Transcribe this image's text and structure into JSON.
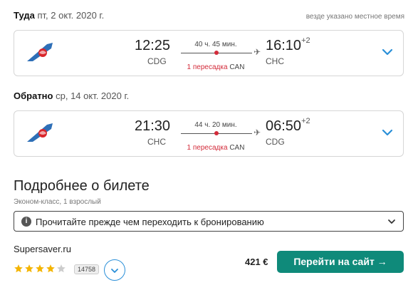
{
  "outbound": {
    "label": "Туда",
    "date": "пт, 2 окт. 2020 г.",
    "dep_time": "12:25",
    "dep_code": "CDG",
    "duration": "40 ч. 45 мин.",
    "arr_time": "16:10",
    "arr_offset": "+2",
    "arr_code": "CHC",
    "stops": "1 пересадка",
    "stop_airport": "CAN"
  },
  "timezone_note": "везде указано местное время",
  "inbound": {
    "label": "Обратно",
    "date": "ср, 14 окт. 2020 г.",
    "dep_time": "21:30",
    "dep_code": "CHC",
    "duration": "44 ч. 20 мин.",
    "arr_time": "06:50",
    "arr_offset": "+2",
    "arr_code": "CDG",
    "stops": "1 пересадка",
    "stop_airport": "CAN"
  },
  "details": {
    "title": "Подробнее о билете",
    "class_info": "Эконом-класс, 1 взрослый",
    "notice": "Прочитайте прежде чем переходить к бронированию"
  },
  "offer": {
    "agency": "Supersaver.ru",
    "rating": 4,
    "rating_max": 5,
    "reviews": "14758",
    "price": "421 €",
    "cta_label": "Перейти на сайт →"
  },
  "icons": {
    "airline_logo": "china-southern-logo",
    "expand": "chevron-down-icon",
    "plane": "plane-icon",
    "info": "info-icon",
    "star": "star-icon"
  },
  "colors": {
    "accent_blue": "#2a8fd8",
    "cta_green": "#0f8a7a",
    "stop_red": "#d32b3a",
    "star_gold": "#f4b400",
    "star_empty": "#cccccc"
  }
}
